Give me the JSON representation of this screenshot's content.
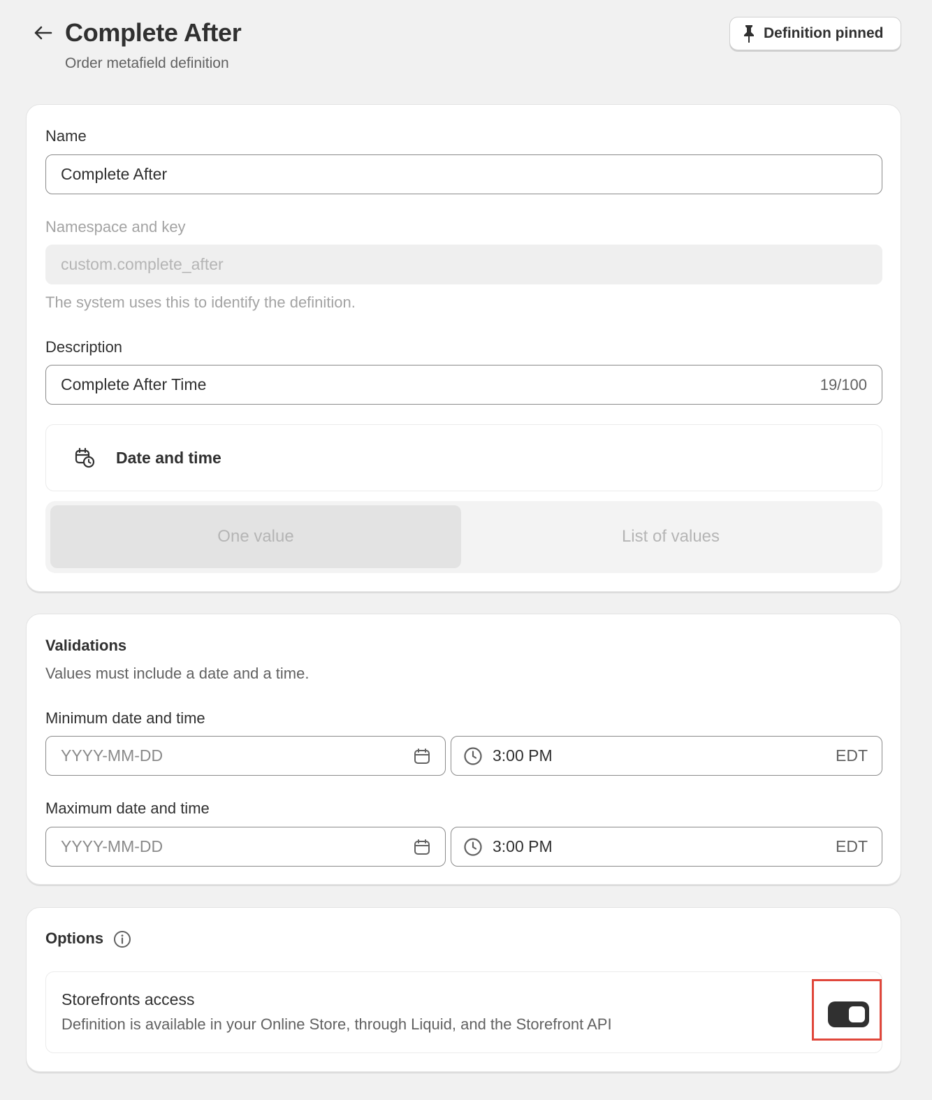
{
  "header": {
    "title": "Complete After",
    "subtitle": "Order metafield definition",
    "pin_button_label": "Definition pinned"
  },
  "general": {
    "name_label": "Name",
    "name_value": "Complete After",
    "namespace_label": "Namespace and key",
    "namespace_value": "custom.complete_after",
    "namespace_help": "The system uses this to identify the definition.",
    "description_label": "Description",
    "description_value": "Complete After Time",
    "description_counter": "19/100",
    "type_label": "Date and time",
    "value_options": [
      "One value",
      "List of values"
    ],
    "selected_value_option": "One value"
  },
  "validations": {
    "title": "Validations",
    "subtitle": "Values must include a date and a time.",
    "min_label": "Minimum date and time",
    "min_date_placeholder": "YYYY-MM-DD",
    "min_time": "3:00 PM",
    "min_timezone": "EDT",
    "max_label": "Maximum date and time",
    "max_date_placeholder": "YYYY-MM-DD",
    "max_time": "3:00 PM",
    "max_timezone": "EDT"
  },
  "options": {
    "title": "Options",
    "storefront_title": "Storefronts access",
    "storefront_desc": "Definition is available in your Online Store, through Liquid, and the Storefront API",
    "storefront_enabled": true
  },
  "colors": {
    "toggle_on": "#303030",
    "highlight_frame": "#e0473b"
  }
}
